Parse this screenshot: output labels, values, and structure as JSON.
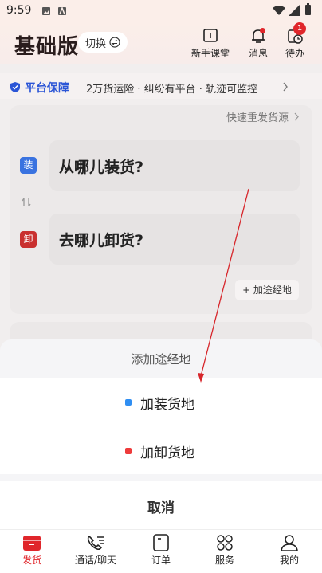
{
  "status_bar": {
    "time": "9:59"
  },
  "header": {
    "brand": "基础版",
    "switch_label": "切换",
    "buttons": [
      {
        "label": "新手课堂",
        "icon": "book-icon"
      },
      {
        "label": "消息",
        "icon": "bell-icon"
      },
      {
        "label": "待办",
        "icon": "todo-clock-icon",
        "badge": "1"
      }
    ]
  },
  "guarantee": {
    "title": "平台保障",
    "text": "2万货运险 · 纠纷有平台 · 轨迹可监控"
  },
  "route_card": {
    "quick_reissue": "快速重发货源",
    "load": {
      "tag": "装",
      "placeholder": "从哪儿装货?"
    },
    "unload": {
      "tag": "卸",
      "placeholder": "去哪儿卸货?"
    },
    "add_stop": "+ 加途经地"
  },
  "sheet": {
    "title": "添加途经地",
    "options": [
      {
        "label": "加装货地",
        "color": "#2f8ef2"
      },
      {
        "label": "加卸货地",
        "color": "#ee3b3b"
      }
    ],
    "cancel": "取消"
  },
  "tabbar": {
    "items": [
      {
        "label": "发货",
        "icon": "truck-box-icon",
        "active": true
      },
      {
        "label": "通话/聊天",
        "icon": "phone-chat-icon"
      },
      {
        "label": "订单",
        "icon": "order-icon"
      },
      {
        "label": "服务",
        "icon": "grid-services-icon"
      },
      {
        "label": "我的",
        "icon": "user-icon"
      }
    ]
  },
  "colors": {
    "accent": "#e0262b",
    "brand_blue": "#2b55d6",
    "load_tag": "#3a73e0",
    "unload_tag": "#c9302f"
  }
}
